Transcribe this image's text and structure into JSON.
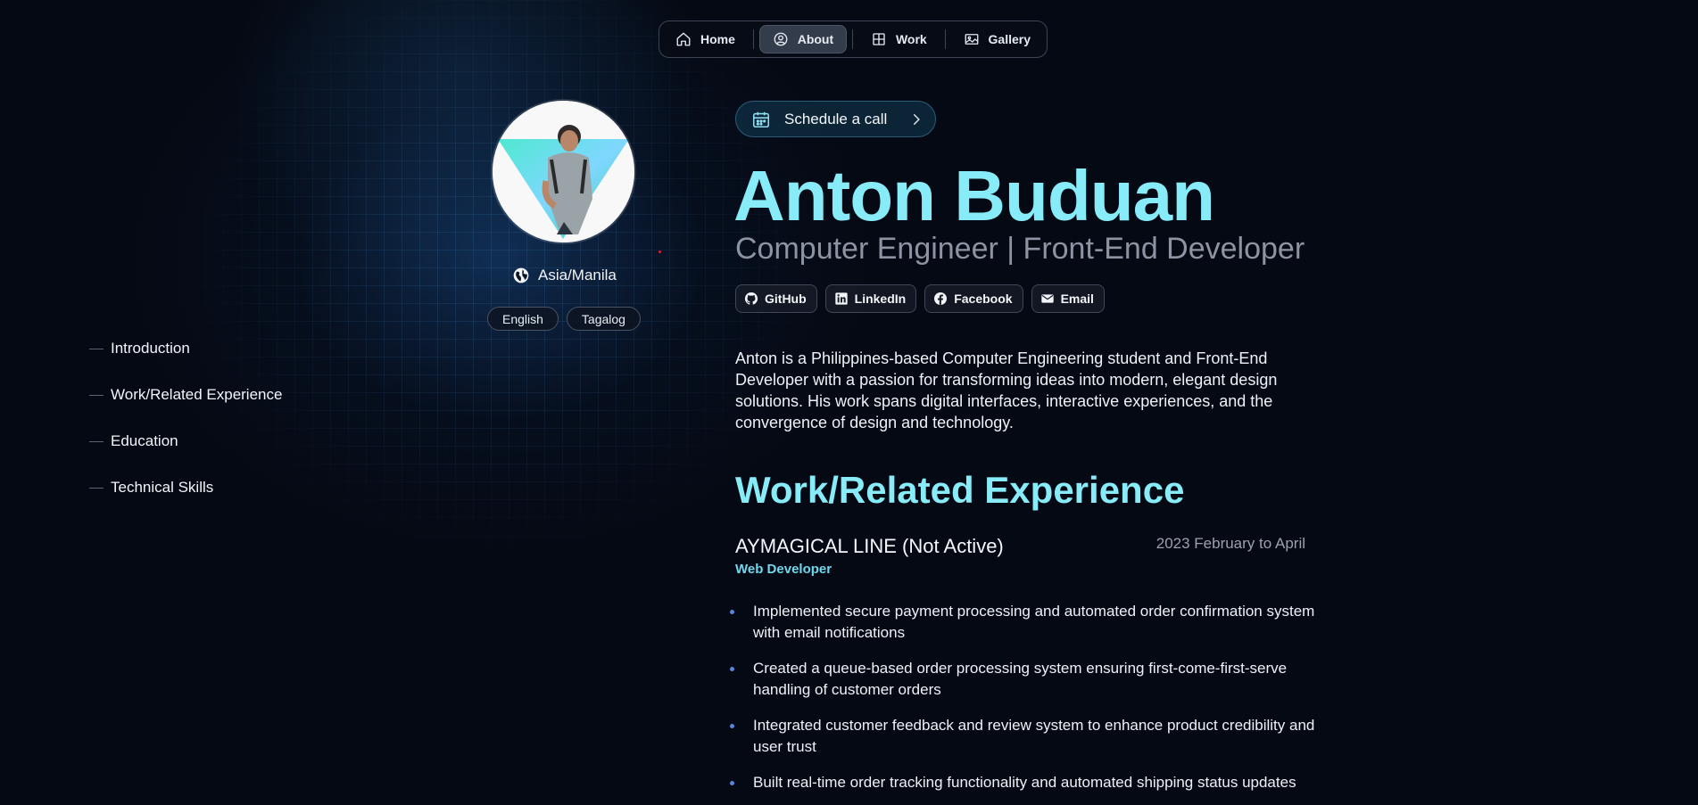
{
  "nav": {
    "items": [
      {
        "label": "Home",
        "icon": "home-icon"
      },
      {
        "label": "About",
        "icon": "user-circle-icon",
        "active": true
      },
      {
        "label": "Work",
        "icon": "grid-icon"
      },
      {
        "label": "Gallery",
        "icon": "image-icon"
      }
    ]
  },
  "profile": {
    "location": "Asia/Manila",
    "location_icon": "globe-icon",
    "languages": [
      "English",
      "Tagalog"
    ]
  },
  "toc": {
    "items": [
      "Introduction",
      "Work/Related Experience",
      "Education",
      "Technical Skills"
    ]
  },
  "hero": {
    "schedule_label": "Schedule a call",
    "name": "Anton Buduan",
    "role": "Computer Engineer | Front-End Developer",
    "socials": [
      {
        "label": "GitHub",
        "icon": "github-icon"
      },
      {
        "label": "LinkedIn",
        "icon": "linkedin-icon"
      },
      {
        "label": "Facebook",
        "icon": "facebook-icon"
      },
      {
        "label": "Email",
        "icon": "email-icon"
      }
    ],
    "intro": "Anton is a Philippines-based Computer Engineering student and Front-End Developer with a passion for transforming ideas into modern, elegant design solutions. His work spans digital interfaces, interactive experiences, and the convergence of design and technology."
  },
  "experience": {
    "title": "Work/Related Experience",
    "jobs": [
      {
        "company": "AYMAGICAL LINE (Not Active)",
        "period": "2023 February to April",
        "role": "Web Developer",
        "bullets": [
          "Implemented secure payment processing and automated order confirmation system with email notifications",
          "Created a queue-based order processing system ensuring first-come-first-serve handling of customer orders",
          "Integrated customer feedback and review system to enhance product credibility and user trust",
          "Built real-time order tracking functionality and automated shipping status updates"
        ]
      }
    ]
  },
  "colors": {
    "accent": "#87ecf8",
    "background": "#050913",
    "muted": "#8c93a2"
  }
}
